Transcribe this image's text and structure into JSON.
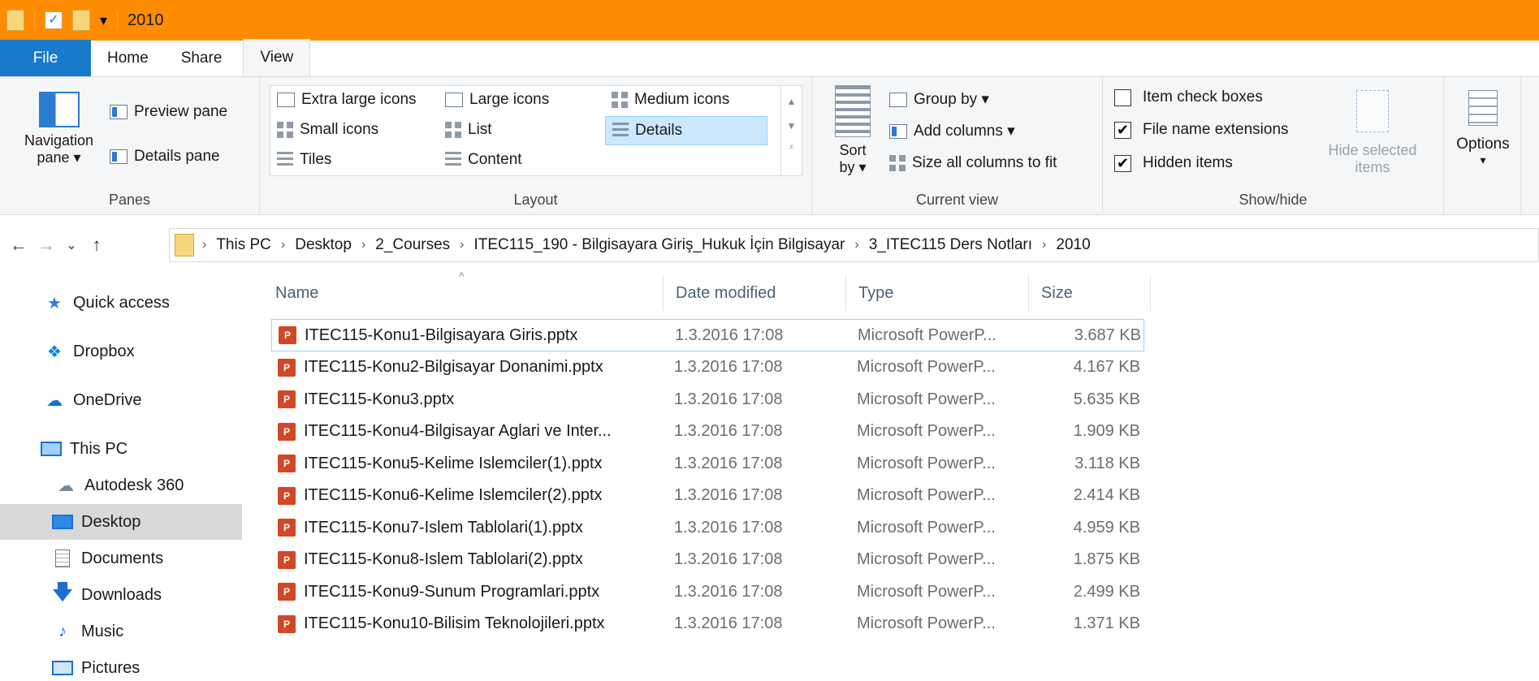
{
  "window": {
    "title": "2010"
  },
  "tabs": {
    "file": "File",
    "home": "Home",
    "share": "Share",
    "view": "View"
  },
  "ribbon": {
    "panes": {
      "navigation_pane": "Navigation",
      "navigation_pane_2": "pane ▾",
      "preview_pane": "Preview pane",
      "details_pane": "Details pane",
      "label": "Panes"
    },
    "layout": {
      "extra_large": "Extra large icons",
      "large": "Large icons",
      "medium": "Medium icons",
      "small": "Small icons",
      "list": "List",
      "details": "Details",
      "tiles": "Tiles",
      "content": "Content",
      "label": "Layout"
    },
    "current_view": {
      "sort_by_1": "Sort",
      "sort_by_2": "by ▾",
      "group_by": "Group by ▾",
      "add_columns": "Add columns ▾",
      "size_columns": "Size all columns to fit",
      "label": "Current view"
    },
    "show_hide": {
      "item_check_boxes": "Item check boxes",
      "file_name_extensions": "File name extensions",
      "hidden_items": "Hidden items",
      "hide_selected_1": "Hide selected",
      "hide_selected_2": "items",
      "label": "Show/hide",
      "check_mark": "✔"
    },
    "options": {
      "label": "Options",
      "arrow": "▾"
    }
  },
  "addressbar": {
    "back": "←",
    "forward": "→",
    "recent": "⌄",
    "up": "↑",
    "separator": "›",
    "crumbs": [
      "This PC",
      "Desktop",
      "2_Courses",
      "ITEC115_190 - Bilgisayara Giriş_Hukuk İçin Bilgisayar",
      "3_ITEC115 Ders Notları",
      "2010"
    ]
  },
  "navpane": {
    "items": [
      {
        "label": "Quick access"
      },
      {
        "label": "Dropbox"
      },
      {
        "label": "OneDrive"
      },
      {
        "label": "This PC"
      },
      {
        "label": "Autodesk 360"
      },
      {
        "label": "Desktop"
      },
      {
        "label": "Documents"
      },
      {
        "label": "Downloads"
      },
      {
        "label": "Music"
      },
      {
        "label": "Pictures"
      }
    ]
  },
  "filelist": {
    "columns": {
      "name": "Name",
      "date": "Date modified",
      "type": "Type",
      "size": "Size"
    },
    "sort_indicator": "^",
    "file_icon_letter": "P",
    "rows": [
      {
        "name": "ITEC115-Konu1-Bilgisayara Giris.pptx",
        "date": "1.3.2016 17:08",
        "type": "Microsoft PowerP...",
        "size": "3.687 KB"
      },
      {
        "name": "ITEC115-Konu2-Bilgisayar Donanimi.pptx",
        "date": "1.3.2016 17:08",
        "type": "Microsoft PowerP...",
        "size": "4.167 KB"
      },
      {
        "name": "ITEC115-Konu3.pptx",
        "date": "1.3.2016 17:08",
        "type": "Microsoft PowerP...",
        "size": "5.635 KB"
      },
      {
        "name": "ITEC115-Konu4-Bilgisayar Aglari ve Inter...",
        "date": "1.3.2016 17:08",
        "type": "Microsoft PowerP...",
        "size": "1.909 KB"
      },
      {
        "name": "ITEC115-Konu5-Kelime Islemciler(1).pptx",
        "date": "1.3.2016 17:08",
        "type": "Microsoft PowerP...",
        "size": "3.118 KB"
      },
      {
        "name": "ITEC115-Konu6-Kelime Islemciler(2).pptx",
        "date": "1.3.2016 17:08",
        "type": "Microsoft PowerP...",
        "size": "2.414 KB"
      },
      {
        "name": "ITEC115-Konu7-Islem Tablolari(1).pptx",
        "date": "1.3.2016 17:08",
        "type": "Microsoft PowerP...",
        "size": "4.959 KB"
      },
      {
        "name": "ITEC115-Konu8-Islem Tablolari(2).pptx",
        "date": "1.3.2016 17:08",
        "type": "Microsoft PowerP...",
        "size": "1.875 KB"
      },
      {
        "name": "ITEC115-Konu9-Sunum Programlari.pptx",
        "date": "1.3.2016 17:08",
        "type": "Microsoft PowerP...",
        "size": "2.499 KB"
      },
      {
        "name": "ITEC115-Konu10-Bilisim Teknolojileri.pptx",
        "date": "1.3.2016 17:08",
        "type": "Microsoft PowerP...",
        "size": "1.371 KB"
      }
    ]
  },
  "colors": {
    "titlebar": "#ff8c00",
    "file_tab": "#1979ca",
    "selection": "#cce8ff",
    "nav_selected": "#d9d9d9",
    "ppt_icon": "#d24726"
  }
}
